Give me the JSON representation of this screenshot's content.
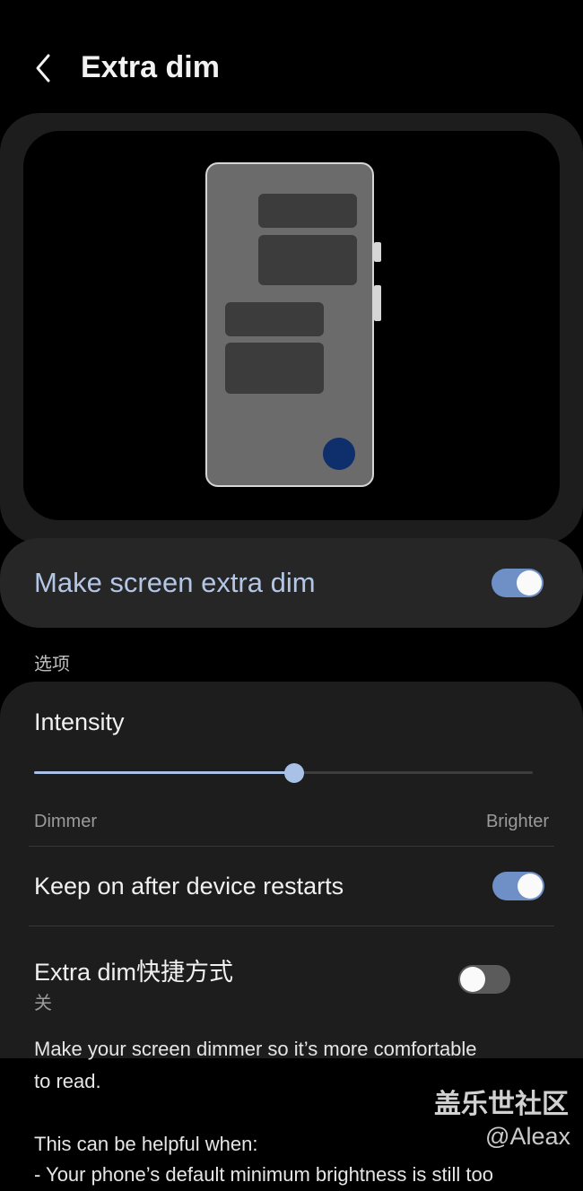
{
  "header": {
    "title": "Extra dim"
  },
  "main_toggle": {
    "label": "Make screen extra dim",
    "on": true
  },
  "section": {
    "header": "选项"
  },
  "intensity": {
    "label": "Intensity",
    "min_label": "Dimmer",
    "max_label": "Brighter",
    "value_fraction": 0.52
  },
  "keep_on": {
    "label": "Keep on after device restarts",
    "on": true
  },
  "shortcut": {
    "label": "Extra dim快捷方式",
    "status": "关",
    "on": false
  },
  "description": {
    "paragraph1_line1": "Make your screen dimmer so it’s more comfortable",
    "paragraph1_line2": "to read.",
    "paragraph2_line1": "This can be helpful when:",
    "paragraph2_line2": "- Your phone’s default minimum brightness is still too"
  },
  "watermark": {
    "line1": "盖乐世社区",
    "line2": "@Aleax"
  },
  "colors": {
    "accent": "#6f8fc7",
    "accent_light": "#a9c1e6",
    "card_bg": "#1d1d1d",
    "main_card_bg": "#262626",
    "preview_fab": "#0e2f6b"
  },
  "icons": {
    "back": "chevron-left-icon"
  }
}
